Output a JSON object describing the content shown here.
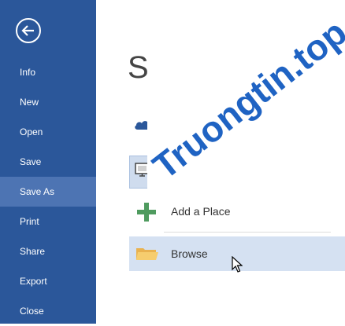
{
  "sidebar": {
    "items": [
      {
        "label": "Info"
      },
      {
        "label": "New"
      },
      {
        "label": "Open"
      },
      {
        "label": "Save"
      },
      {
        "label": "Save As"
      },
      {
        "label": "Print"
      },
      {
        "label": "Share"
      },
      {
        "label": "Export"
      },
      {
        "label": "Close"
      }
    ],
    "active": "Save As"
  },
  "main": {
    "title": "Sa",
    "locations": {
      "add_place": "Add a Place",
      "browse": "Browse"
    }
  },
  "watermark": {
    "text": "Truongtin.top"
  },
  "icons": {
    "back": "back-arrow-icon",
    "onedrive": "cloud-icon",
    "computer": "computer-icon",
    "add": "plus-icon",
    "browse": "folder-icon",
    "cursor": "mouse-pointer-icon"
  },
  "colors": {
    "sidebar": "#2b579a",
    "sidebar_active": "#4d74b3",
    "highlight": "#d5e1f2",
    "plus": "#4f9b5f",
    "watermark": "#1f63c3"
  }
}
